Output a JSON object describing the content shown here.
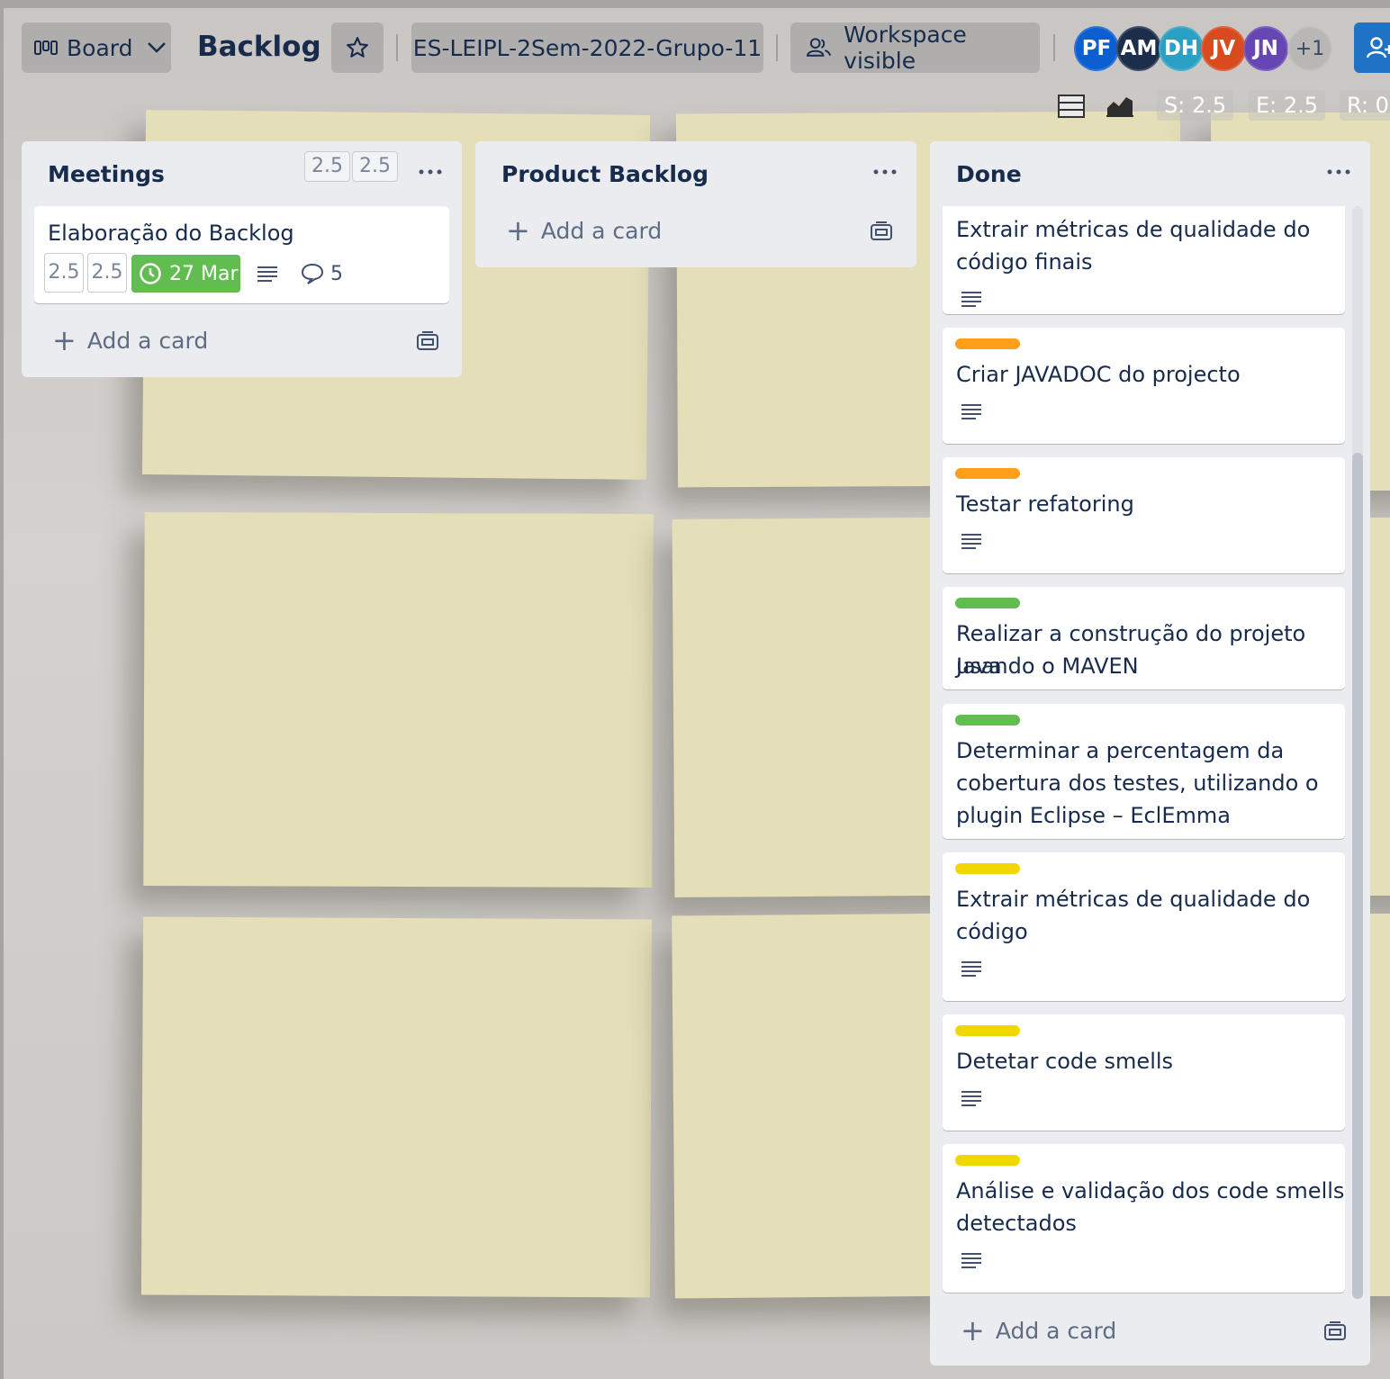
{
  "header": {
    "view_button_label": "Board",
    "board_title": "Backlog",
    "workspace_label": "ES-LEIPL-2Sem-2022-Grupo-11",
    "visibility_label": "Workspace visible",
    "members": [
      {
        "initials": "PF",
        "color": "#0b5fd1"
      },
      {
        "initials": "AM",
        "color": "#1c2e4a"
      },
      {
        "initials": "DH",
        "color": "#2aa1c4"
      },
      {
        "initials": "JV",
        "color": "#d94a1e"
      },
      {
        "initials": "JN",
        "color": "#6646b3"
      }
    ],
    "more_members": "+1",
    "stats": {
      "s": "S: 2.5",
      "e": "E: 2.5",
      "r": "R: 0"
    }
  },
  "lists": {
    "meetings": {
      "title": "Meetings",
      "badges": [
        "2.5",
        "2.5"
      ],
      "cards": [
        {
          "title": "Elaboração do Backlog",
          "badges": [
            "2.5",
            "2.5"
          ],
          "due": "27 Mar",
          "comments": "5"
        }
      ],
      "add_label": "Add a card"
    },
    "product_backlog": {
      "title": "Product Backlog",
      "add_label": "Add a card"
    },
    "done": {
      "title": "Done",
      "add_label": "Add a card",
      "cards": [
        {
          "title_lines": [
            "Extrair métricas de qualidade do",
            "código finais"
          ],
          "label_color": null
        },
        {
          "title_lines": [
            "Criar JAVADOC do projecto"
          ],
          "label_color": "#ff9f1a"
        },
        {
          "title_lines": [
            "Testar refatoring"
          ],
          "label_color": "#ff9f1a"
        },
        {
          "title_lines": [
            "Realizar a construção do projeto Java",
            "usando o MAVEN"
          ],
          "label_color": "#61bd4f"
        },
        {
          "title_lines": [
            "Determinar a percentagem da",
            "cobertura dos testes, utilizando o",
            "plugin Eclipse – EclEmma"
          ],
          "label_color": "#61bd4f"
        },
        {
          "title_lines": [
            "Extrair métricas de qualidade do",
            "código"
          ],
          "label_color": "#f2d600"
        },
        {
          "title_lines": [
            "Detetar code smells"
          ],
          "label_color": "#f2d600"
        },
        {
          "title_lines": [
            "Análise e validação dos code smells",
            "detectados"
          ],
          "label_color": "#f2d600"
        }
      ]
    }
  },
  "colors": {
    "due_badge": "#61bd4f",
    "share_button": "#1f72c4",
    "list_bg": "#ebecf0"
  }
}
